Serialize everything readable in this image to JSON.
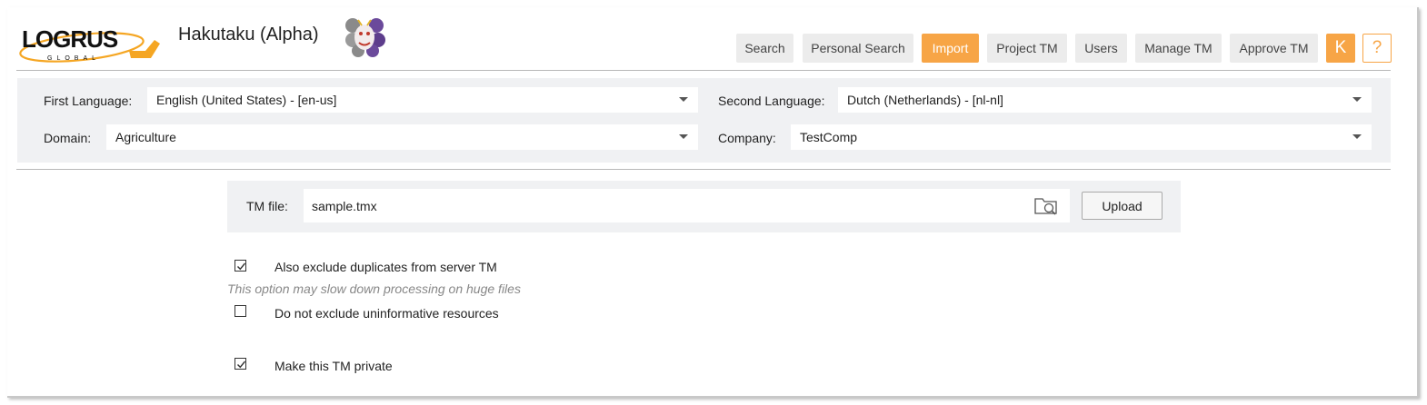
{
  "header": {
    "logo_text": "LOGRUS",
    "logo_subtext": "GLOBAL",
    "app_title": "Hakutaku (Alpha)"
  },
  "nav": {
    "items": [
      {
        "label": "Search",
        "active": false
      },
      {
        "label": "Personal Search",
        "active": false
      },
      {
        "label": "Import",
        "active": true
      },
      {
        "label": "Project TM",
        "active": false
      },
      {
        "label": "Users",
        "active": false
      },
      {
        "label": "Manage TM",
        "active": false
      },
      {
        "label": "Approve TM",
        "active": false
      }
    ],
    "user_initial": "K",
    "help_label": "?"
  },
  "filters": {
    "first_language_label": "First Language:",
    "first_language_value": "English (United States) - [en-us]",
    "second_language_label": "Second Language:",
    "second_language_value": "Dutch (Netherlands) - [nl-nl]",
    "domain_label": "Domain:",
    "domain_value": "Agriculture",
    "company_label": "Company:",
    "company_value": "TestComp"
  },
  "tm_file": {
    "label": "TM file:",
    "value": "sample.tmx",
    "upload_label": "Upload"
  },
  "options": {
    "exclude_duplicates": {
      "label": "Also exclude duplicates from server TM",
      "checked": true
    },
    "exclude_duplicates_hint": "This option may slow down processing on huge files",
    "uninformative": {
      "label": "Do not exclude uninformative resources",
      "checked": false
    },
    "private": {
      "label": "Make this TM private",
      "checked": true
    }
  },
  "colors": {
    "accent": "#f7a546",
    "panel": "#f0f1f3",
    "nav_button": "#ececec"
  }
}
